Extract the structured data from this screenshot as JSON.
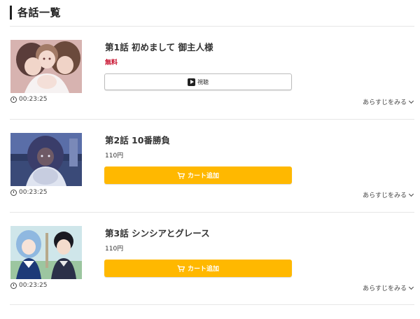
{
  "section": {
    "title": "各話一覧"
  },
  "episodes": [
    {
      "title": "第1話 初めまして 御主人様",
      "price": "無料",
      "duration": "00:23:25",
      "action_label": "視聴",
      "synopsis_label": "あらすじをみる"
    },
    {
      "title": "第2話 10番勝負",
      "price": "110円",
      "duration": "00:23:25",
      "action_label": "カート追加",
      "synopsis_label": "あらすじをみる"
    },
    {
      "title": "第3話 シンシアとグレース",
      "price": "110円",
      "duration": "00:23:25",
      "action_label": "カート追加",
      "synopsis_label": "あらすじをみる"
    }
  ],
  "colors": {
    "free_price": "#c8102e",
    "cart_button": "#ffb800",
    "divider": "#e6e6e6"
  },
  "icons": {
    "watch": "play-icon",
    "cart": "cart-icon",
    "duration": "clock-icon",
    "synopsis": "chevron-down-icon"
  }
}
